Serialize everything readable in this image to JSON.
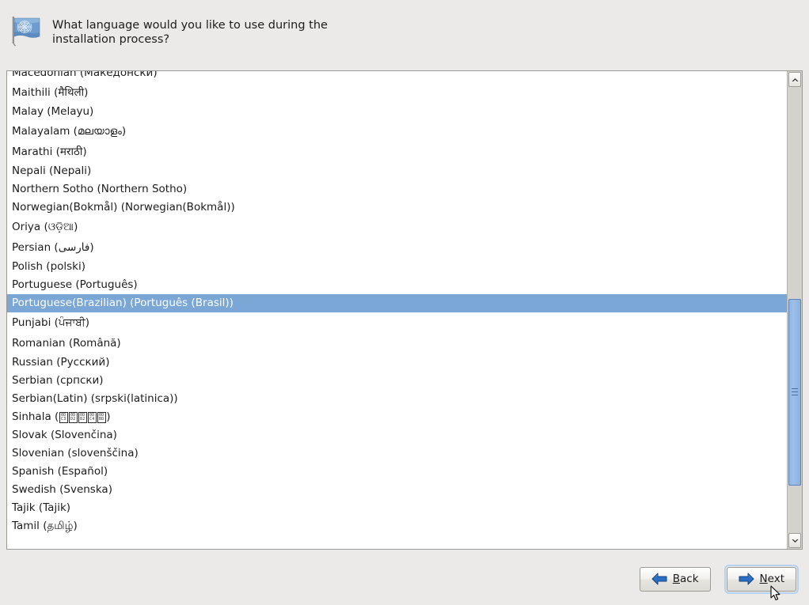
{
  "header": {
    "icon": "un-flag-icon",
    "prompt": "What language would you like to use during the\ninstallation process?"
  },
  "language_list": {
    "selected": "Portuguese(Brazilian) (Português (Brasil))",
    "items": [
      {
        "label": "Macedonian (Македонски)",
        "size": "normal"
      },
      {
        "label": "Maithili (मैथिली)",
        "size": "tall"
      },
      {
        "label": "Malay (Melayu)",
        "size": "normal"
      },
      {
        "label": "Malayalam (മലയാളം)",
        "size": "tall"
      },
      {
        "label": "Marathi (मराठी)",
        "size": "tall"
      },
      {
        "label": "Nepali (Nepali)",
        "size": "normal"
      },
      {
        "label": "Northern Sotho (Northern Sotho)",
        "size": "normal"
      },
      {
        "label": "Norwegian(Bokmål) (Norwegian(Bokmål))",
        "size": "normal"
      },
      {
        "label": "Oriya (ଓଡ଼ିଆ)",
        "size": "tall"
      },
      {
        "label": "Persian (فارسی)",
        "size": "tall"
      },
      {
        "label": "Polish (polski)",
        "size": "normal"
      },
      {
        "label": "Portuguese (Português)",
        "size": "normal"
      },
      {
        "label": "Portuguese(Brazilian) (Português (Brasil))",
        "size": "normal",
        "selected": true
      },
      {
        "label": "Punjabi (ਪੰਜਾਬੀ)",
        "size": "tall"
      },
      {
        "label": "Romanian (Română)",
        "size": "tall"
      },
      {
        "label": "Russian (Русский)",
        "size": "normal"
      },
      {
        "label": "Serbian (српски)",
        "size": "normal"
      },
      {
        "label": "Serbian(Latin) (srpski(latinica))",
        "size": "normal"
      },
      {
        "label": "Sinhala (",
        "size": "normal",
        "tofu": [
          "0DC3",
          "0DD2",
          "0D82",
          "0DC4",
          "0DBD"
        ],
        "label_suffix": ")"
      },
      {
        "label": "Slovak (Slovenčina)",
        "size": "normal"
      },
      {
        "label": "Slovenian (slovenščina)",
        "size": "normal"
      },
      {
        "label": "Spanish (Español)",
        "size": "normal"
      },
      {
        "label": "Swedish (Svenska)",
        "size": "normal"
      },
      {
        "label": "Tajik (Tajik)",
        "size": "normal"
      },
      {
        "label": "Tamil (தமிழ்)",
        "size": "normal"
      }
    ]
  },
  "scrollbar": {
    "up_arrow": "chevron-up-icon",
    "down_arrow": "chevron-down-icon",
    "thumb_top_pct": 47.5,
    "thumb_height_pct": 42
  },
  "buttons": {
    "back": {
      "label": "Back",
      "mnemonic": "B",
      "rest": "ack",
      "icon": "arrow-left-icon"
    },
    "next": {
      "label": "Next",
      "mnemonic": "N",
      "rest": "ext",
      "icon": "arrow-right-icon",
      "focused": true
    }
  },
  "colors": {
    "background": "#ebeae8",
    "selection": "#7ba7d7",
    "list_background": "#ffffff",
    "scroll_thumb": "#8fb5e2",
    "arrow_blue": "#2b6fc4",
    "focus_ring": "#b7d2ef"
  }
}
